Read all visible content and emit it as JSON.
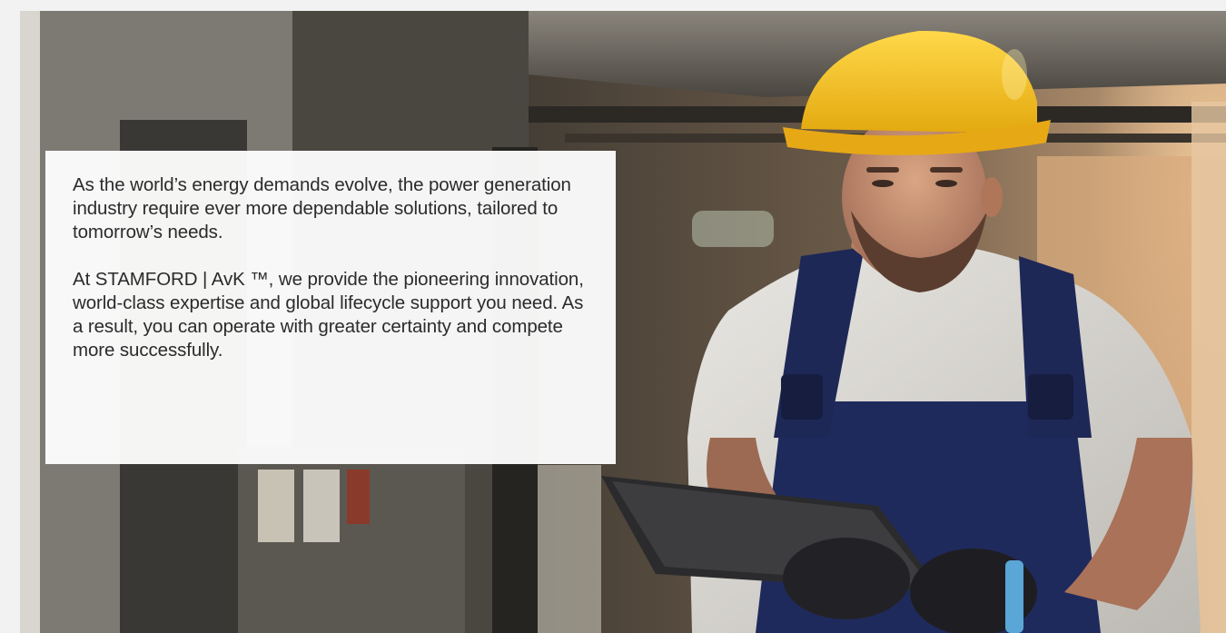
{
  "hero": {
    "image_subject": "Worker in yellow hard hat and navy overalls using a tablet in an industrial plant"
  },
  "content": {
    "paragraph_1": "As the world’s energy demands evolve, the power generation industry require ever more dependable solutions, tailored to tomorrow’s needs.",
    "paragraph_2": "At STAMFORD | AvK ™, we provide the pioneering innovation, world-class expertise and global lifecycle support you need. As a result, you can operate with greater certainty and compete more successfully."
  },
  "colors": {
    "page_background": "#f2f2f2",
    "card_background": "#ffffff",
    "body_text": "#2b2b2b",
    "hard_hat": "#f3bf1f",
    "overalls": "#1f2a5c"
  }
}
